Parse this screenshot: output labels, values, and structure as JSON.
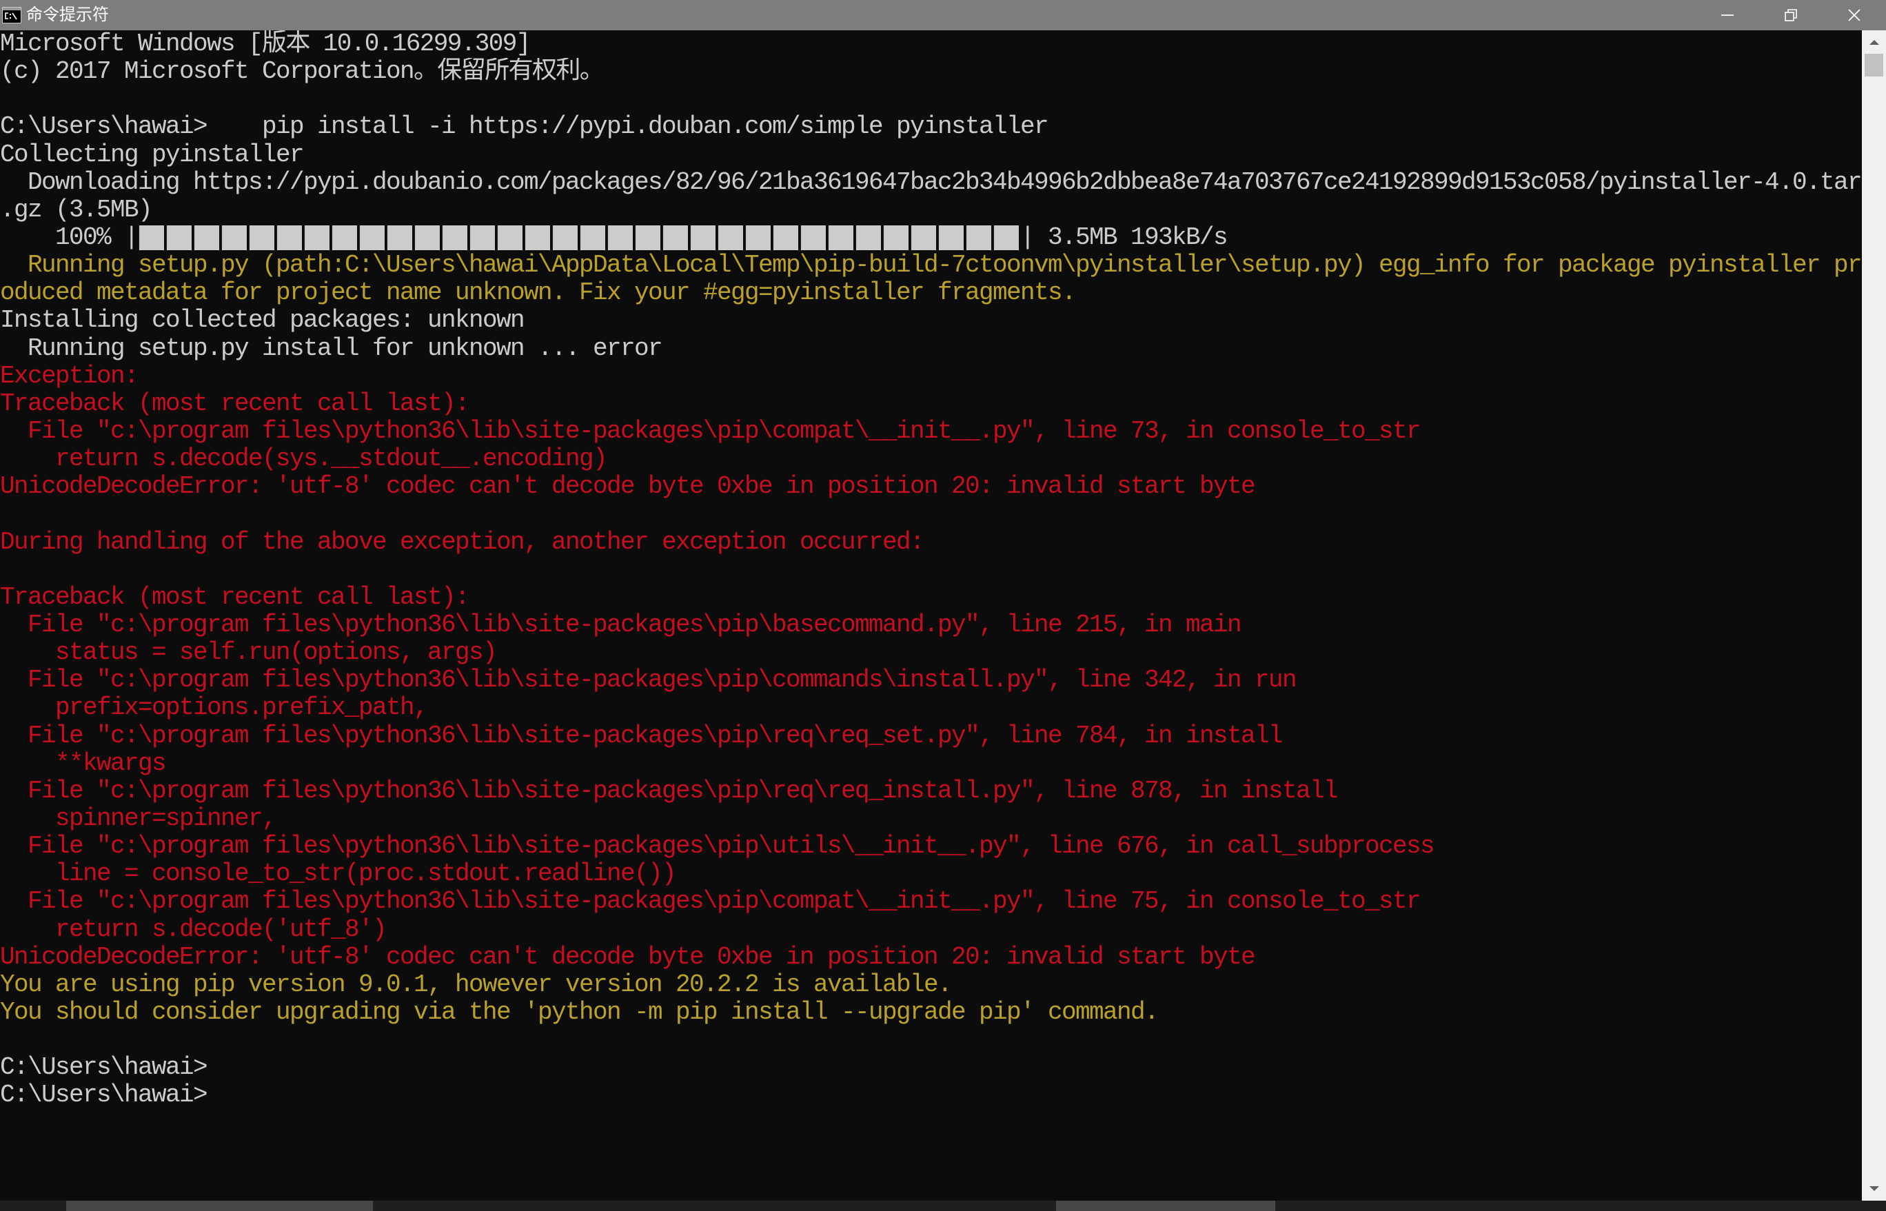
{
  "window": {
    "title": "命令提示符"
  },
  "icons": {
    "app": "cmd-icon",
    "minimize": "minimize-icon",
    "restore": "restore-icon",
    "close": "close-icon",
    "scroll_up": "scroll-up-arrow-icon",
    "scroll_down": "scroll-down-arrow-icon"
  },
  "colors": {
    "titlebar": "#7D7D7D",
    "titlebar_text": "#FFFFFF",
    "console_background": "#0C0C0C",
    "default": "#CCCCCC",
    "yellow": "#BAA22A",
    "red": "#C50F1F",
    "scrollbar_track": "#F0F0F0",
    "scrollbar_thumb": "#C1C1C1"
  },
  "scrollbar": {
    "position": 0,
    "thumb_fraction": 0.02
  },
  "console": {
    "lines": [
      {
        "text": "Microsoft Windows [版本 10.0.16299.309]",
        "color": "default"
      },
      {
        "text": "(c) 2017 Microsoft Corporation。保留所有权利。",
        "color": "default"
      },
      {
        "text": "",
        "color": "default"
      },
      {
        "text": "C:\\Users\\hawai>    pip install -i https://pypi.douban.com/simple pyinstaller",
        "color": "default"
      },
      {
        "text": "Collecting pyinstaller",
        "color": "default"
      },
      {
        "text": "  Downloading https://pypi.doubanio.com/packages/82/96/21ba3619647bac2b34b4996b2dbbea8e74a703767ce24192899d9153c058/pyinstaller-4.0.tar",
        "color": "default"
      },
      {
        "text": ".gz (3.5MB)",
        "color": "default"
      },
      {
        "type": "progress",
        "prefix": "    100% |",
        "bar": "████████████████████████████████",
        "suffix": "| 3.5MB 193kB/s",
        "fill": 1.0,
        "color": "default"
      },
      {
        "text": "  Running setup.py (path:C:\\Users\\hawai\\AppData\\Local\\Temp\\pip-build-7ctoonvm\\pyinstaller\\setup.py) egg_info for package pyinstaller pr",
        "color": "yellow"
      },
      {
        "text": "oduced metadata for project name unknown. Fix your #egg=pyinstaller fragments.",
        "color": "yellow"
      },
      {
        "text": "Installing collected packages: unknown",
        "color": "default"
      },
      {
        "text": "  Running setup.py install for unknown ... error",
        "color": "default"
      },
      {
        "text": "Exception:",
        "color": "red"
      },
      {
        "text": "Traceback (most recent call last):",
        "color": "red"
      },
      {
        "text": "  File \"c:\\program files\\python36\\lib\\site-packages\\pip\\compat\\__init__.py\", line 73, in console_to_str",
        "color": "red"
      },
      {
        "text": "    return s.decode(sys.__stdout__.encoding)",
        "color": "red"
      },
      {
        "text": "UnicodeDecodeError: 'utf-8' codec can't decode byte 0xbe in position 20: invalid start byte",
        "color": "red"
      },
      {
        "text": "",
        "color": "red"
      },
      {
        "text": "During handling of the above exception, another exception occurred:",
        "color": "red"
      },
      {
        "text": "",
        "color": "red"
      },
      {
        "text": "Traceback (most recent call last):",
        "color": "red"
      },
      {
        "text": "  File \"c:\\program files\\python36\\lib\\site-packages\\pip\\basecommand.py\", line 215, in main",
        "color": "red"
      },
      {
        "text": "    status = self.run(options, args)",
        "color": "red"
      },
      {
        "text": "  File \"c:\\program files\\python36\\lib\\site-packages\\pip\\commands\\install.py\", line 342, in run",
        "color": "red"
      },
      {
        "text": "    prefix=options.prefix_path,",
        "color": "red"
      },
      {
        "text": "  File \"c:\\program files\\python36\\lib\\site-packages\\pip\\req\\req_set.py\", line 784, in install",
        "color": "red"
      },
      {
        "text": "    **kwargs",
        "color": "red"
      },
      {
        "text": "  File \"c:\\program files\\python36\\lib\\site-packages\\pip\\req\\req_install.py\", line 878, in install",
        "color": "red"
      },
      {
        "text": "    spinner=spinner,",
        "color": "red"
      },
      {
        "text": "  File \"c:\\program files\\python36\\lib\\site-packages\\pip\\utils\\__init__.py\", line 676, in call_subprocess",
        "color": "red"
      },
      {
        "text": "    line = console_to_str(proc.stdout.readline())",
        "color": "red"
      },
      {
        "text": "  File \"c:\\program files\\python36\\lib\\site-packages\\pip\\compat\\__init__.py\", line 75, in console_to_str",
        "color": "red"
      },
      {
        "text": "    return s.decode('utf_8')",
        "color": "red"
      },
      {
        "text": "UnicodeDecodeError: 'utf-8' codec can't decode byte 0xbe in position 20: invalid start byte",
        "color": "red"
      },
      {
        "text": "You are using pip version 9.0.1, however version 20.2.2 is available.",
        "color": "yellow"
      },
      {
        "text": "You should consider upgrading via the 'python -m pip install --upgrade pip' command.",
        "color": "yellow"
      },
      {
        "text": "",
        "color": "default"
      },
      {
        "text": "C:\\Users\\hawai>",
        "color": "default"
      },
      {
        "text": "C:\\Users\\hawai>",
        "color": "default"
      }
    ]
  }
}
